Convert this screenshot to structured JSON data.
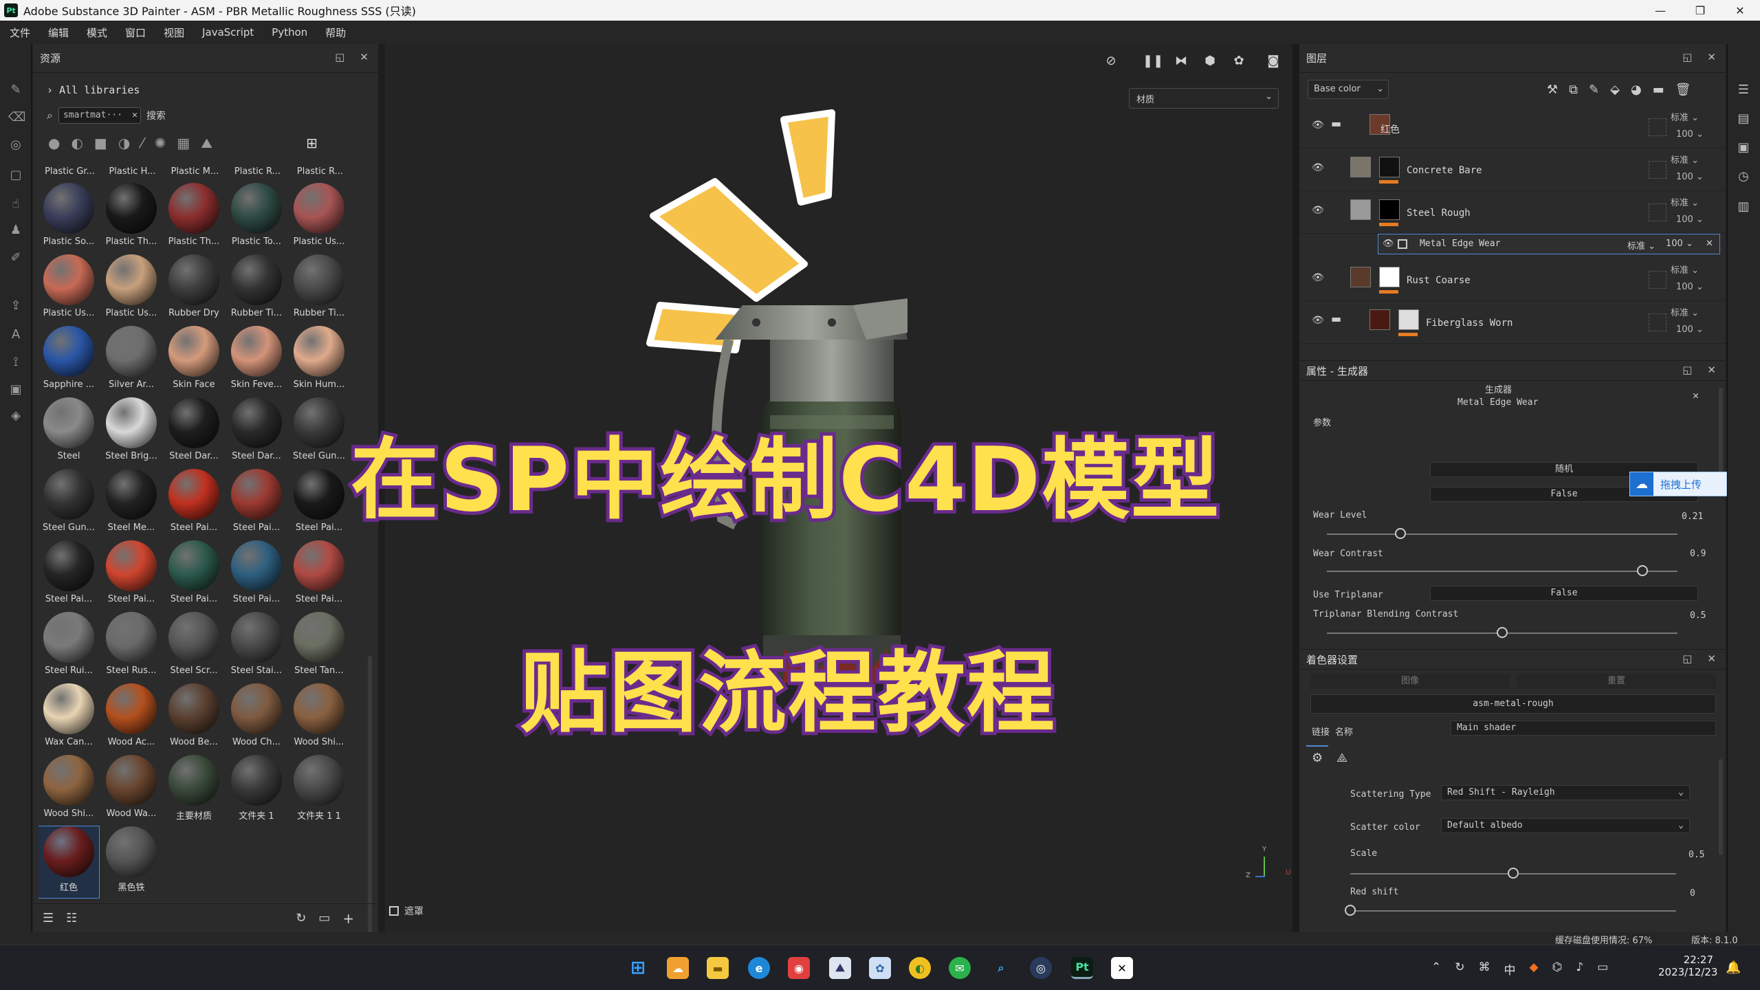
{
  "window": {
    "title": "Adobe Substance 3D Painter - ASM - PBR Metallic Roughness SSS (只读)",
    "app_icon_text": "Pt",
    "min": "—",
    "max": "❐",
    "close": "✕"
  },
  "menu": [
    "文件",
    "编辑",
    "模式",
    "窗口",
    "视图",
    "JavaScript",
    "Python",
    "帮助"
  ],
  "assets": {
    "title": "资源",
    "all_libraries": "All libraries",
    "search_value": "smartmat···",
    "search_label": "搜索",
    "top_row_labels": [
      "Plastic Gr...",
      "Plastic H...",
      "Plastic M...",
      "Plastic R...",
      "Plastic R..."
    ],
    "items": [
      {
        "label": "Plastic So...",
        "color": "#3a3e5a"
      },
      {
        "label": "Plastic Th...",
        "color": "#1a1a1a"
      },
      {
        "label": "Plastic Th...",
        "color": "#8c2e2e"
      },
      {
        "label": "Plastic To...",
        "color": "#2f4a44"
      },
      {
        "label": "Plastic Us...",
        "color": "#a85454"
      },
      {
        "label": "Plastic Us...",
        "color": "#c86a56"
      },
      {
        "label": "Plastic Us...",
        "color": "#c8a07c"
      },
      {
        "label": "Rubber Dry",
        "color": "#3e3e3e"
      },
      {
        "label": "Rubber Ti...",
        "color": "#333333"
      },
      {
        "label": "Rubber Ti...",
        "color": "#4a4a4a"
      },
      {
        "label": "Sapphire ...",
        "color": "#2a56a6"
      },
      {
        "label": "Silver Ar...",
        "color": "#6e6e6e"
      },
      {
        "label": "Skin Face",
        "color": "#d49a7c"
      },
      {
        "label": "Skin Feve...",
        "color": "#d4937a"
      },
      {
        "label": "Skin Hum...",
        "color": "#e0aa8c"
      },
      {
        "label": "Steel",
        "color": "#8a8a8a"
      },
      {
        "label": "Steel Brig...",
        "color": "#d8d8d8"
      },
      {
        "label": "Steel Dar...",
        "color": "#1e1e1e"
      },
      {
        "label": "Steel Dar...",
        "color": "#2a2a2a"
      },
      {
        "label": "Steel Gun...",
        "color": "#3a3a3a"
      },
      {
        "label": "Steel Gun...",
        "color": "#333333"
      },
      {
        "label": "Steel Me...",
        "color": "#222222"
      },
      {
        "label": "Steel Pai...",
        "color": "#c0301f"
      },
      {
        "label": "Steel Pai...",
        "color": "#9c3a32"
      },
      {
        "label": "Steel Pai...",
        "color": "#1a1a1a"
      },
      {
        "label": "Steel Pai...",
        "color": "#252525"
      },
      {
        "label": "Steel Pai...",
        "color": "#d0452f"
      },
      {
        "label": "Steel Pai...",
        "color": "#2c5a4c"
      },
      {
        "label": "Steel Pai...",
        "color": "#2e5f80"
      },
      {
        "label": "Steel Pai...",
        "color": "#b04a44"
      },
      {
        "label": "Steel Rui...",
        "color": "#7a7a7a"
      },
      {
        "label": "Steel Rus...",
        "color": "#6a6a6a"
      },
      {
        "label": "Steel Scr...",
        "color": "#555555"
      },
      {
        "label": "Steel Stai...",
        "color": "#4a4a4a"
      },
      {
        "label": "Steel Tan...",
        "color": "#6a6e60"
      },
      {
        "label": "Wax Can...",
        "color": "#e8d4b4"
      },
      {
        "label": "Wood Ac...",
        "color": "#b4501e"
      },
      {
        "label": "Wood Be...",
        "color": "#5a4030"
      },
      {
        "label": "Wood Ch...",
        "color": "#7e5a40"
      },
      {
        "label": "Wood Shi...",
        "color": "#8a6040"
      },
      {
        "label": "Wood Shi...",
        "color": "#8e6440"
      },
      {
        "label": "Wood Wa...",
        "color": "#6a4630"
      },
      {
        "label": "主要材质",
        "color": "#3a4a3a"
      },
      {
        "label": "文件夹 1",
        "color": "#3a3a3a"
      },
      {
        "label": "文件夹 1 1",
        "color": "#4a4a4a"
      },
      {
        "label": "红色",
        "color": "#6a1e1e",
        "selected": true
      },
      {
        "label": "黑色铁",
        "color": "#555555"
      }
    ]
  },
  "viewport": {
    "material_select": "材质",
    "mask_label": "遮罩",
    "axis_y": "Y",
    "axis_z": "Z",
    "axis_u": "U"
  },
  "overlay": {
    "line1": "在SP中绘制C4D模型",
    "line2": "贴图流程教程"
  },
  "layers": {
    "title": "图层",
    "channel": "Base color",
    "rows": [
      {
        "name": "红色",
        "blend": "标准",
        "opacity": "100",
        "type": "folder"
      },
      {
        "name": "Concrete Bare",
        "blend": "标准",
        "opacity": "100"
      },
      {
        "name": "Steel Rough",
        "blend": "标准",
        "opacity": "100"
      },
      {
        "name": "Rust Coarse",
        "blend": "标准",
        "opacity": "100"
      },
      {
        "name": "Fiberglass Worn",
        "blend": "标准",
        "opacity": "100",
        "type": "folder"
      }
    ],
    "sub_layer": {
      "name": "Metal Edge Wear",
      "blend": "标准",
      "opacity": "100"
    }
  },
  "properties": {
    "title": "属性 - 生成器",
    "header": "生成器",
    "generator_name": "Metal Edge Wear",
    "section": "参数",
    "seed_value": "随机",
    "bool_value": "False",
    "wear_level_label": "Wear Level",
    "wear_level_value": "0.21",
    "wear_level_fraction": 0.21,
    "wear_contrast_label": "Wear Contrast",
    "wear_contrast_value": "0.9",
    "wear_contrast_fraction": 0.9,
    "use_triplanar_label": "Use Triplanar",
    "use_triplanar_value": "False",
    "triplanar_contrast_label": "Triplanar Blending Contrast",
    "triplanar_contrast_value": "0.5",
    "triplanar_contrast_fraction": 0.5
  },
  "upload": {
    "label": "拖拽上传"
  },
  "shader": {
    "title": "着色器设置",
    "tab1": "图像",
    "tab2": "重置",
    "preset": "asm-metal-rough",
    "link_label": "链接 名称",
    "shader_name": "Main shader",
    "scattering_type_label": "Scattering Type",
    "scattering_type": "Red Shift - Rayleigh",
    "scatter_color_label": "Scatter color",
    "scatter_color": "Default albedo",
    "scale_label": "Scale",
    "scale_value": "0.5",
    "scale_fraction": 0.5,
    "red_shift_label": "Red shift",
    "red_shift_value": "0",
    "red_shift_fraction": 0
  },
  "status": {
    "cache": "缓存磁盘使用情况: 67%",
    "version": "版本: 8.1.0"
  },
  "taskbar": {
    "time": "22:27",
    "date": "2023/12/23",
    "ime": "中"
  }
}
